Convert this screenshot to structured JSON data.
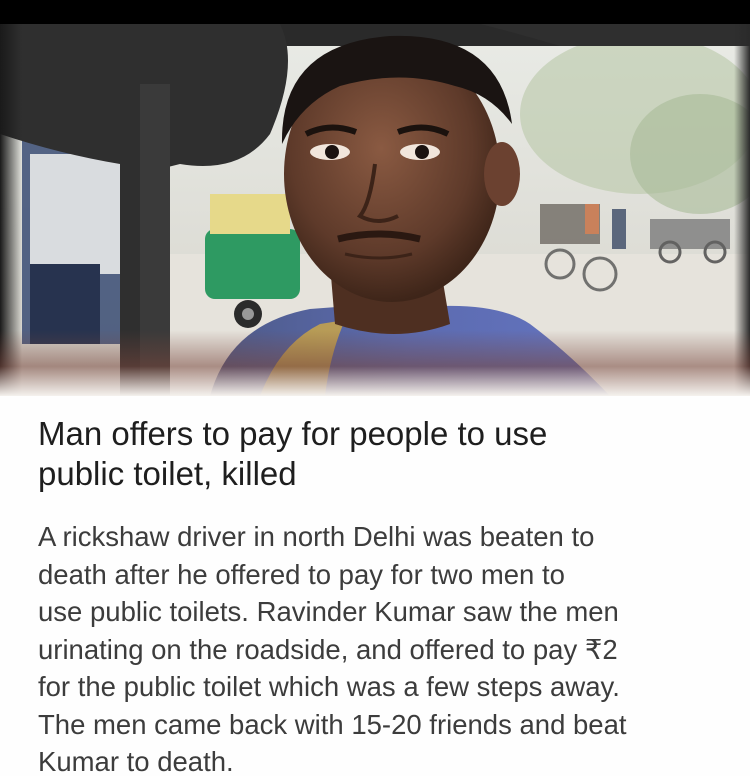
{
  "article": {
    "headline_line1": "Man offers to pay for people to use",
    "headline_line2": "public toilet, killed",
    "body_lines": [
      "A rickshaw driver in north Delhi was beaten to",
      "death after he offered to pay for two men to",
      "use public toilets. Ravinder Kumar saw the men",
      "urinating on the roadside, and offered to pay ₹2",
      "for the public toilet which was a few steps away.",
      "The men came back with 15-20 friends and beat",
      "Kumar to death."
    ]
  },
  "colors": {
    "page_background": "#000000",
    "card_background": "#fefefe",
    "headline_text": "#1e1e1e",
    "body_text": "#3c3c3c"
  }
}
